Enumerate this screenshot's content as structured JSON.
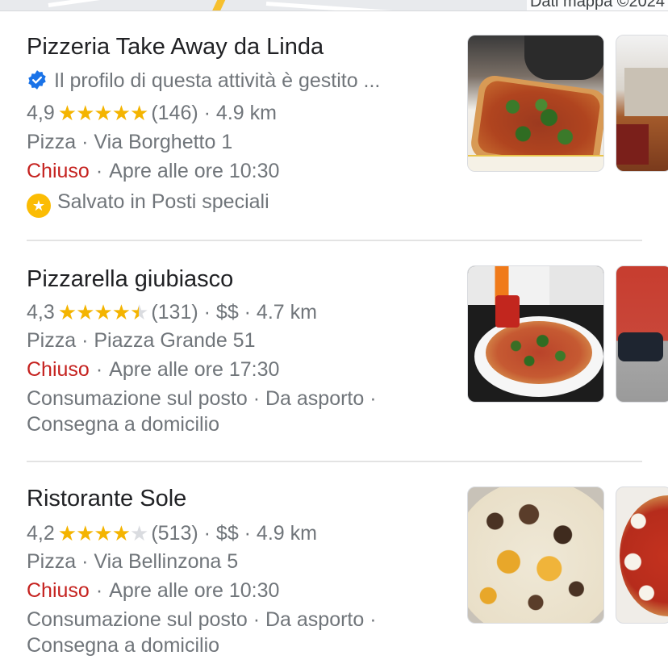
{
  "map": {
    "credit": "Dati mappa ©2024"
  },
  "listings": [
    {
      "name": "Pizzeria Take Away da Linda",
      "verified_text": "Il profilo di questa attività è gestito ...",
      "rating": "4,9",
      "stars": 5,
      "reviews": "(146)",
      "distance": "· 4.9 km",
      "category_address": "Pizza · Via Borghetto 1",
      "status": "Chiuso",
      "hours": "Apre alle ore 10:30",
      "saved_text": "Salvato in Posti speciali"
    },
    {
      "name": "Pizzarella giubiasco",
      "rating": "4,3",
      "stars": 4.5,
      "reviews": "(131)",
      "price_distance": "· $$ · 4.7 km",
      "category_address": "Pizza · Piazza Grande 51",
      "status": "Chiuso",
      "hours": "Apre alle ore 17:30",
      "services_line1": "Consumazione sul posto · Da asporto ·",
      "services_line2": "Consegna a domicilio"
    },
    {
      "name": "Ristorante Sole",
      "rating": "4,2",
      "stars": 4,
      "reviews": "(513)",
      "price_distance": "· $$ · 4.9 km",
      "category_address": "Pizza · Via Bellinzona 5",
      "status": "Chiuso",
      "hours": "Apre alle ore 10:30",
      "services_line1": "Consumazione sul posto · Da asporto ·",
      "services_line2": "Consegna a domicilio"
    }
  ],
  "colors": {
    "star": "#f4b400",
    "closed": "#c5221f",
    "verified": "#1a73e8",
    "saved": "#fbbc04"
  }
}
